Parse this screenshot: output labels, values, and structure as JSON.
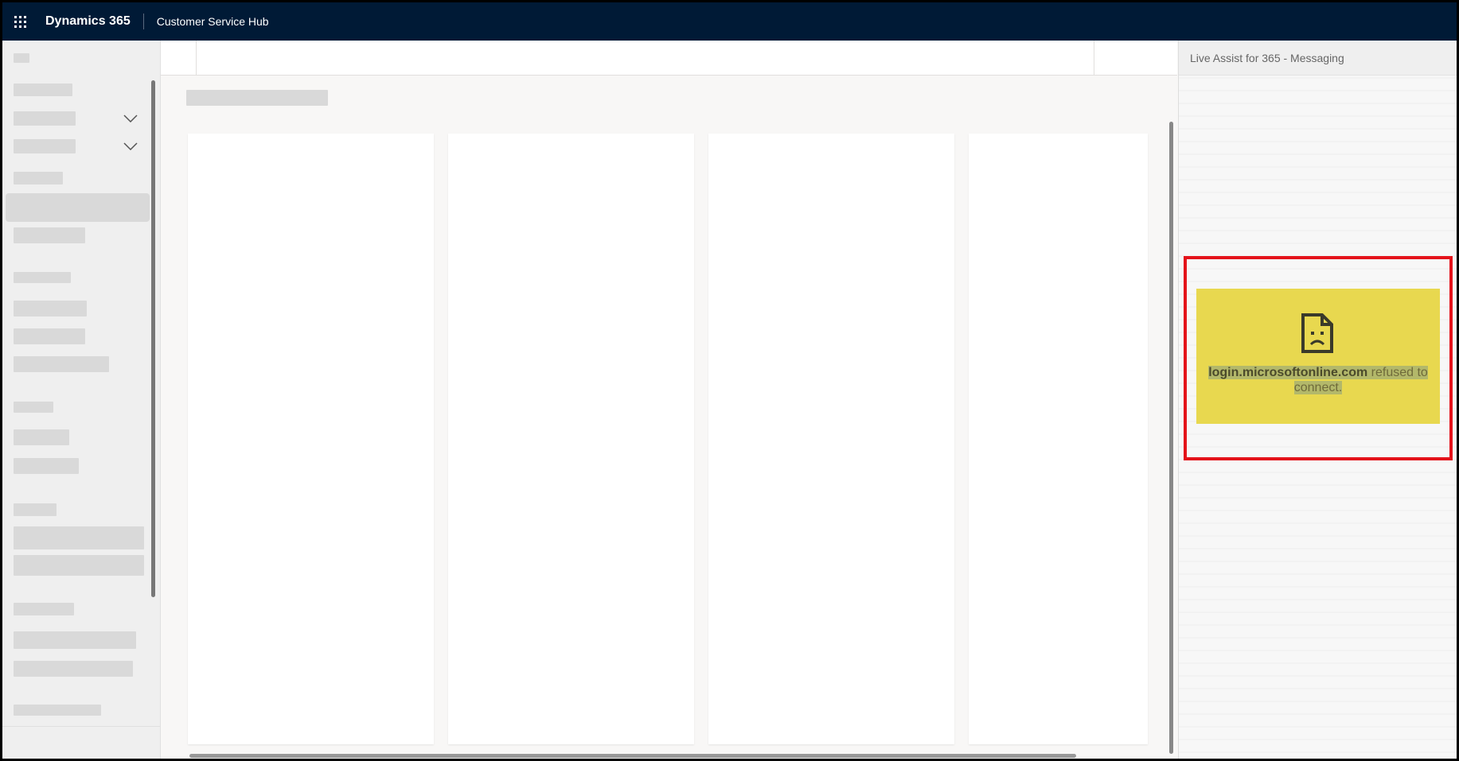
{
  "topbar": {
    "brand": "Dynamics 365",
    "app_name": "Customer Service Hub",
    "app_launcher_icon": "waffle-icon"
  },
  "right_panel": {
    "title": "Live Assist for 365 - Messaging",
    "error": {
      "icon": "sad-document-icon",
      "domain": "login.microsoftonline.com",
      "message": " refused to connect."
    },
    "highlight_color": "#e4121a",
    "error_bg": "#e8d84f"
  },
  "colors": {
    "topbar_bg": "#001a36",
    "page_bg": "#f8f7f6"
  }
}
